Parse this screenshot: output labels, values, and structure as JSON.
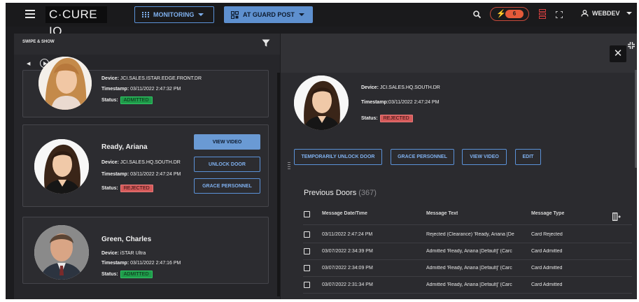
{
  "app": {
    "logo": "C·CURE IQ",
    "monitoring_label": "MONITORING",
    "guard_post_label": "AT GUARD POST",
    "alarm_count": "6",
    "user_name": "WEBDEV"
  },
  "left_panel": {
    "title": "SWIPE & SHOW",
    "cards": [
      {
        "name": "",
        "device_label": "Device:",
        "device": "JCI.SALES.ISTAR.EDGE.FRONT.DR",
        "timestamp_label": "Timestamp:",
        "timestamp": "03/11/2022 2:47:32 PM",
        "status_label": "Status:",
        "status": "ADMITTED"
      },
      {
        "name": "Ready, Ariana",
        "device_label": "Device:",
        "device": "JCI.SALES.HQ.SOUTH.DR",
        "timestamp_label": "Timestamp:",
        "timestamp": "03/11/2022 2:47:24 PM",
        "status_label": "Status:",
        "status": "REJECTED",
        "actions": [
          "VIEW VIDEO",
          "UNLOCK DOOR",
          "GRACE PERSONNEL"
        ]
      },
      {
        "name": "Green, Charles",
        "device_label": "Device:",
        "device": "iSTAR Ultra",
        "timestamp_label": "Timestamp:",
        "timestamp": "03/11/2022 2:47:16 PM",
        "status_label": "Status:",
        "status": "ADMITTED"
      }
    ]
  },
  "detail": {
    "device_label": "Device:",
    "device": "JCI.SALES.HQ.SOUTH.DR",
    "timestamp_label": "Timestamp:",
    "timestamp": "03/11/2022 2:47:24 PM",
    "status_label": "Status:",
    "status": "REJECTED",
    "actions": [
      "TEMPORARILY UNLOCK DOOR",
      "GRACE PERSONNEL",
      "VIEW VIDEO",
      "EDIT"
    ],
    "previous_doors_title": "Previous Doors",
    "previous_doors_count": "(367)",
    "columns": [
      "Message Date/Time",
      "Message Text",
      "Message Type"
    ],
    "rows": [
      {
        "date": "03/11/2022 2:47:24 PM",
        "text": "Rejected (Clearance) 'Ready, Ariana [De",
        "type": "Card Rejected"
      },
      {
        "date": "03/07/2022 2:34:39 PM",
        "text": "Admitted 'Ready, Ariana [Default]' (Carc",
        "type": "Card Admitted"
      },
      {
        "date": "03/07/2022 2:34:09 PM",
        "text": "Admitted 'Ready, Ariana [Default]' (Carc",
        "type": "Card Admitted"
      },
      {
        "date": "03/07/2022 2:31:34 PM",
        "text": "Admitted 'Ready, Ariana [Default]' (Carc",
        "type": "Card Admitted"
      }
    ]
  },
  "colors": {
    "accent": "#5e90cf",
    "admitted": "#1f9b4a",
    "rejected": "#d55a5a",
    "alarm": "#e45a3a"
  }
}
